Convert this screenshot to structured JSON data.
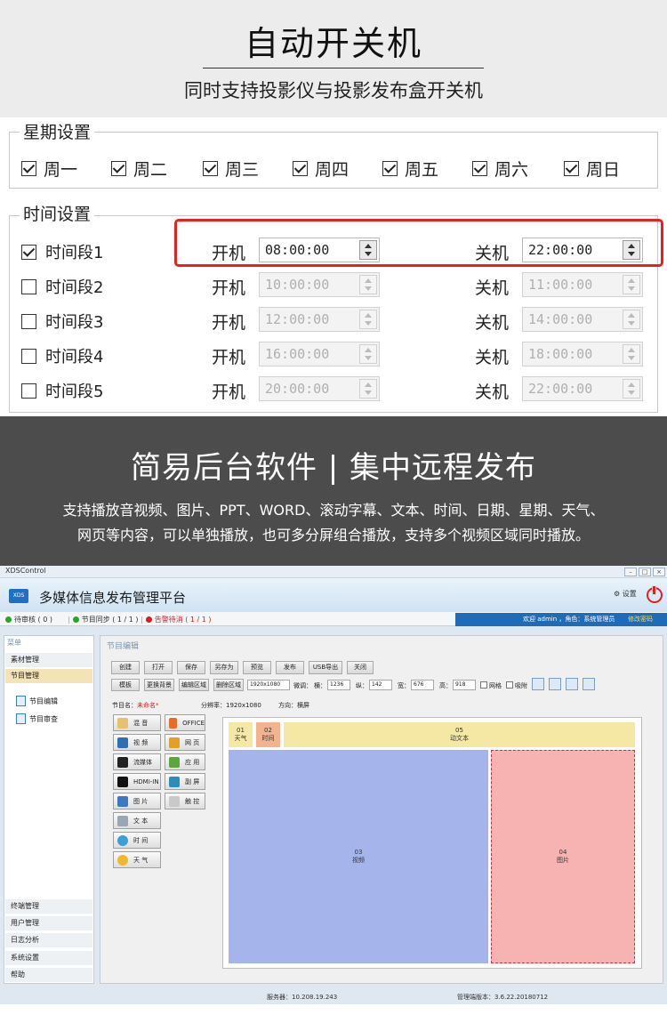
{
  "banner": {
    "title": "自动开关机",
    "subtitle": "同时支持投影仪与投影发布盒开关机"
  },
  "weekday_settings": {
    "title": "星期设置",
    "days": [
      {
        "label": "周一",
        "checked": true
      },
      {
        "label": "周二",
        "checked": true
      },
      {
        "label": "周三",
        "checked": true
      },
      {
        "label": "周四",
        "checked": true
      },
      {
        "label": "周五",
        "checked": true
      },
      {
        "label": "周六",
        "checked": true
      },
      {
        "label": "周日",
        "checked": true
      }
    ]
  },
  "time_settings": {
    "title": "时间设置",
    "on_label": "开机",
    "off_label": "关机",
    "segments": [
      {
        "label": "时间段1",
        "checked": true,
        "on": "08:00:00",
        "off": "22:00:00"
      },
      {
        "label": "时间段2",
        "checked": false,
        "on": "10:00:00",
        "off": "11:00:00"
      },
      {
        "label": "时间段3",
        "checked": false,
        "on": "12:00:00",
        "off": "14:00:00"
      },
      {
        "label": "时间段4",
        "checked": false,
        "on": "16:00:00",
        "off": "18:00:00"
      },
      {
        "label": "时间段5",
        "checked": false,
        "on": "20:00:00",
        "off": "22:00:00"
      }
    ]
  },
  "feature": {
    "title": "简易后台软件 | 集中远程发布",
    "desc_line1": "支持播放音视频、图片、PPT、WORD、滚动字幕、文本、时间、日期、星期、天气、",
    "desc_line2": "网页等内容，可以单独播放，也可多分屏组合播放，支持多个视频区域同时播放。"
  },
  "app": {
    "window_title": "XDSControl",
    "logo": "XDS",
    "title": "多媒体信息发布管理平台",
    "settings_label": "⚙ 设置",
    "status": [
      {
        "text": "待审核 ( 0 )",
        "color": "#2aa52a"
      },
      {
        "text": "节目同步 ( 1 / 1 )",
        "color": "#2aa52a"
      },
      {
        "text": "告警待消 ( 1 / 1 )",
        "color": "#d81e1e"
      }
    ],
    "user_text": "欢迎 admin ，角色：系统管理员",
    "logout": "修改密码",
    "sidebar": {
      "menu_label": "菜单",
      "top_items": [
        "素材管理",
        "节目管理"
      ],
      "sub_items": [
        "节目编辑",
        "节目审查"
      ],
      "bottom_items": [
        "终端管理",
        "用户管理",
        "日志分析",
        "系统设置",
        "帮助"
      ]
    },
    "main_title": "节目编辑",
    "toolbar1": [
      "创建",
      "打开",
      "保存",
      "另存为",
      "预览",
      "发布",
      "USB导出",
      "关闭"
    ],
    "toolbar2": {
      "template": "模板",
      "change_bg": "更换背景",
      "edit_area": "编辑区域",
      "delete_area": "删除区域",
      "resolution": "1920x1080",
      "fine_tune": "微调：",
      "x_label": "横：",
      "x_value": "1236",
      "y_label": "纵：",
      "y_value": "142",
      "w_label": "宽：",
      "w_value": "676",
      "h_label": "高：",
      "h_value": "918",
      "grid": "网格",
      "snap": "吸附"
    },
    "program_info": {
      "name_label": "节目名：",
      "name_value": "未命名*",
      "res_label": "分辨率：",
      "res_value": "1920x1080",
      "dir_label": "方向：",
      "dir_value": "横屏"
    },
    "media_buttons": [
      {
        "label": "混 音",
        "icon": "music-icon",
        "color": "#e6c36a"
      },
      {
        "label": "OFFICE",
        "icon": "office-icon",
        "color": "#e86b2a"
      },
      {
        "label": "视 频",
        "icon": "video-icon",
        "color": "#2e6fb8"
      },
      {
        "label": "网 页",
        "icon": "web-icon",
        "color": "#e0a02a"
      },
      {
        "label": "流媒体",
        "icon": "stream-icon",
        "color": "#222222"
      },
      {
        "label": "应 用",
        "icon": "app-icon",
        "color": "#5aa83a"
      },
      {
        "label": "HDMI-IN",
        "icon": "hdmi-icon",
        "color": "#111111"
      },
      {
        "label": "副 屏",
        "icon": "subscreen-icon",
        "color": "#2a8fb8"
      },
      {
        "label": "图 片",
        "icon": "image-icon",
        "color": "#3a78c4"
      },
      {
        "label": "触 控",
        "icon": "touch-icon",
        "color": "#c9c9c9"
      },
      {
        "label": "文 本",
        "icon": "text-icon",
        "color": "#9aa6b4"
      },
      {
        "label": "时 间",
        "icon": "clock-icon",
        "color": "#3aa0d8"
      },
      {
        "label": "天 气",
        "icon": "weather-icon",
        "color": "#f0b82a"
      }
    ],
    "zones": [
      {
        "id": "01",
        "name": "天气"
      },
      {
        "id": "02",
        "name": "时间"
      },
      {
        "id": "05",
        "name": "动文本"
      },
      {
        "id": "03",
        "name": "视频"
      },
      {
        "id": "04",
        "name": "图片"
      }
    ],
    "footer": {
      "server": "服务器：10.208.19.243",
      "version": "管理端版本：3.6.22.20180712"
    }
  }
}
